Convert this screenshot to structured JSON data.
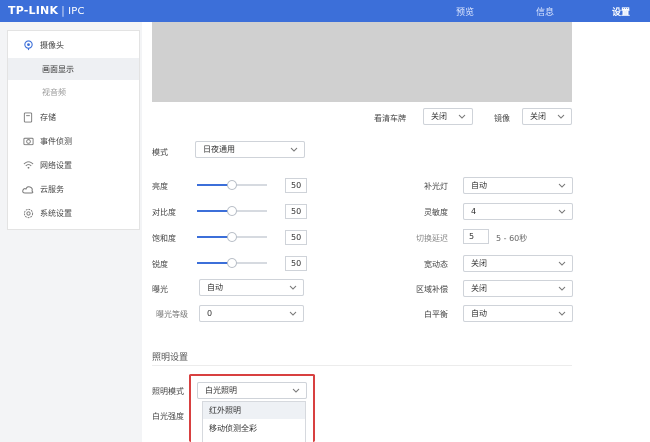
{
  "header": {
    "logo": "TP-LINK",
    "product": "IPC",
    "nav": [
      {
        "label": "预览"
      },
      {
        "label": "信息"
      },
      {
        "label": "设置"
      }
    ]
  },
  "sidebar": {
    "items": [
      {
        "label": "摄像头",
        "icon": "camera-location-icon"
      },
      {
        "label": "存储",
        "icon": "storage-icon"
      },
      {
        "label": "事件侦测",
        "icon": "event-camera-icon"
      },
      {
        "label": "网络设置",
        "icon": "wifi-icon"
      },
      {
        "label": "云服务",
        "icon": "cloud-icon"
      },
      {
        "label": "系统设置",
        "icon": "gear-icon"
      }
    ],
    "subitems": [
      {
        "label": "画面显示"
      },
      {
        "label": "视音频"
      }
    ]
  },
  "preview_controls": {
    "lookplate_label": "看清车牌",
    "lookplate_value": "关闭",
    "mirror_label": "镜像",
    "mirror_value": "关闭"
  },
  "settings": {
    "mode_label": "模式",
    "mode_value": "日夜通用",
    "brightness_label": "亮度",
    "brightness_value": "50",
    "contrast_label": "对比度",
    "contrast_value": "50",
    "saturation_label": "饱和度",
    "saturation_value": "50",
    "sharpness_label": "锐度",
    "sharpness_value": "50",
    "exposure_label": "曝光",
    "exposure_value": "自动",
    "exposure_level_label": "曝光等级",
    "exposure_level_value": "0",
    "fill_light_label": "补光灯",
    "fill_light_value": "自动",
    "sensitivity_label": "灵敏度",
    "sensitivity_value": "4",
    "switch_delay_label": "切换延迟",
    "switch_delay_value": "5",
    "switch_delay_hint": "5 - 60秒",
    "wdr_label": "宽动态",
    "wdr_value": "关闭",
    "blc_label": "区域补偿",
    "blc_value": "关闭",
    "wb_label": "白平衡",
    "wb_value": "自动"
  },
  "lighting": {
    "section_title": "照明设置",
    "mode_label": "照明模式",
    "mode_value": "白光照明",
    "white_strength_label": "白光强度",
    "options": [
      "红外照明",
      "移动侦测全彩"
    ]
  },
  "colors": {
    "accent": "#3c6fd9",
    "highlight_border": "#d84040"
  },
  "slider_levels_percent": {
    "brightness": 50,
    "contrast": 50,
    "saturation": 50,
    "sharpness": 50
  }
}
